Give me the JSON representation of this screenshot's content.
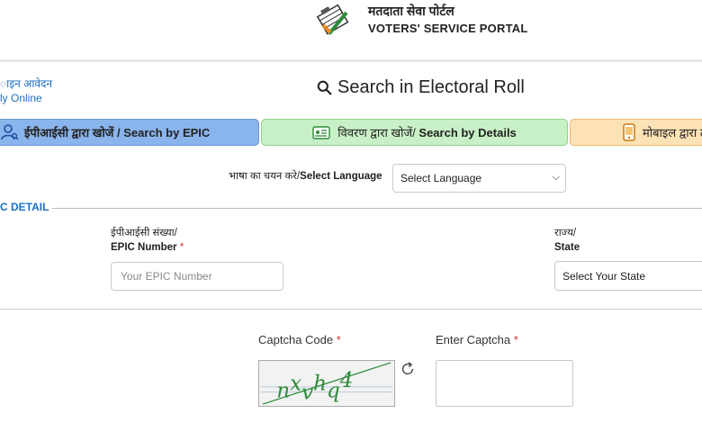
{
  "header": {
    "logo_icon": "voting-checkmark-logo",
    "title_hindi": "मतदाता सेवा पोर्टल",
    "title_english": "VOTERS' SERVICE PORTAL"
  },
  "apply_online": {
    "line1": "ाइन आवेदन",
    "line2": "ly Online"
  },
  "page_title": "Search in Electoral Roll",
  "tabs": [
    {
      "label": "ईपीआईसी द्वारा खोजें / Search by EPIC",
      "icon": "user-search-icon",
      "active": true
    },
    {
      "label_hindi": "विवरण द्वारा खोजें/",
      "label_english": " Search by Details",
      "icon": "id-card-icon"
    },
    {
      "label": "मोबाइल द्वारा ट",
      "icon": "mobile-icon"
    }
  ],
  "language": {
    "label_hindi": "भाषा का चयन करे/",
    "label_english": "Select Language",
    "selected": "Select Language"
  },
  "section": {
    "heading": "C DETAIL"
  },
  "epic_field": {
    "label_hindi": "ईपीआईसी संख्या/",
    "label_english": "EPIC Number",
    "required_mark": "*",
    "placeholder": "Your EPIC Number"
  },
  "state_field": {
    "label_hindi": "राज्य/",
    "label_english": "State",
    "selected": "Select Your State"
  },
  "captcha": {
    "label": "Captcha Code",
    "required_mark": "*",
    "enter_label": "Enter Captcha",
    "code_text": "nxvhq4",
    "refresh_icon": "refresh-icon"
  },
  "colors": {
    "tab_epic": "#8ab4ec",
    "tab_details": "#c8f0c6",
    "tab_mobile": "#fde2b6",
    "accent_blue": "#1a6fc4",
    "required_red": "#d9342b"
  }
}
